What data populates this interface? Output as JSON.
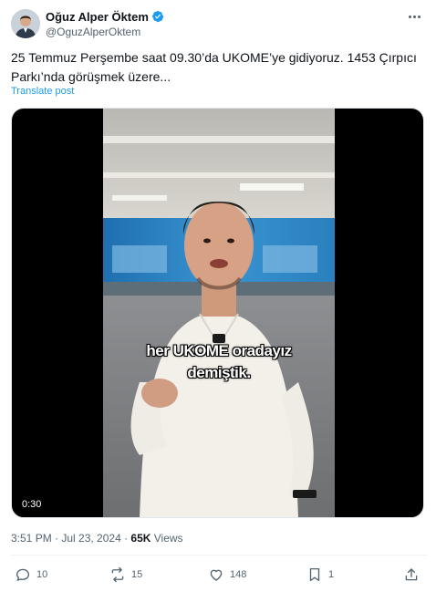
{
  "author": {
    "display_name": "Oğuz Alper Öktem",
    "handle": "@OguzAlperOktem",
    "verified_color": "#1d9bf0"
  },
  "tweet": {
    "text": "25 Temmuz Perşembe saat 09.30’da UKOME’ye gidiyoruz. 1453 Çırpıcı\nParkı’nda görüşmek üzere...",
    "translate_label": "Translate post"
  },
  "video": {
    "caption_line1": "her UKOME oradayız",
    "caption_line2": "demiştik.",
    "duration": "0:30"
  },
  "meta": {
    "time_date": "3:51 PM · Jul 23, 2024 · ",
    "views_count": "65K",
    "views_label": " Views"
  },
  "actions": {
    "replies": "10",
    "reposts": "15",
    "likes": "148",
    "bookmarks": "1"
  },
  "icons": [
    "verified-icon",
    "more-icon",
    "reply-icon",
    "repost-icon",
    "like-icon",
    "bookmark-icon",
    "share-icon"
  ]
}
